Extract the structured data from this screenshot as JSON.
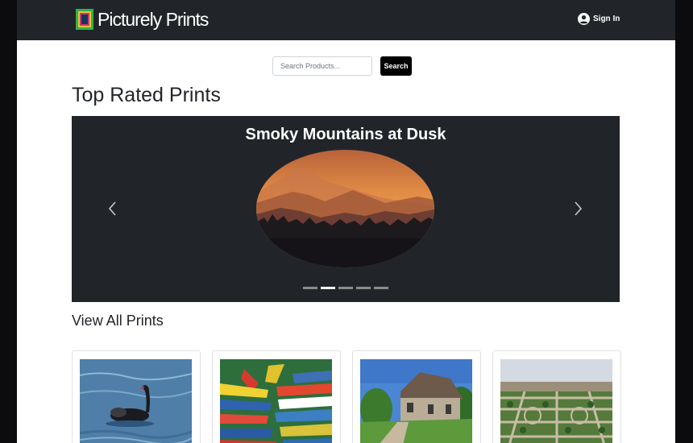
{
  "navbar": {
    "brand": "Picturely Prints",
    "signin_label": "Sign In",
    "signin_icon": "user-circle-icon",
    "logo_icon": "picture-frame-icon"
  },
  "search": {
    "placeholder": "Search Products...",
    "button_label": "Search"
  },
  "top_rated": {
    "title": "Top Rated Prints",
    "carousel": {
      "current_slide_title": "Smoky Mountains at Dusk",
      "prev_icon": "chevron-left-icon",
      "next_icon": "chevron-right-icon",
      "indicator_count": 5,
      "active_indicator": 2
    }
  },
  "all_prints": {
    "title": "View All Prints",
    "products": [
      {
        "image": "black-swan-on-water"
      },
      {
        "image": "colorful-rowboats"
      },
      {
        "image": "stone-chapel-garden"
      },
      {
        "image": "formal-palace-gardens"
      }
    ]
  },
  "colors": {
    "navbar_bg": "#212529",
    "carousel_bg": "#212529",
    "search_button_bg": "#000000",
    "page_bg": "#ffffff"
  }
}
